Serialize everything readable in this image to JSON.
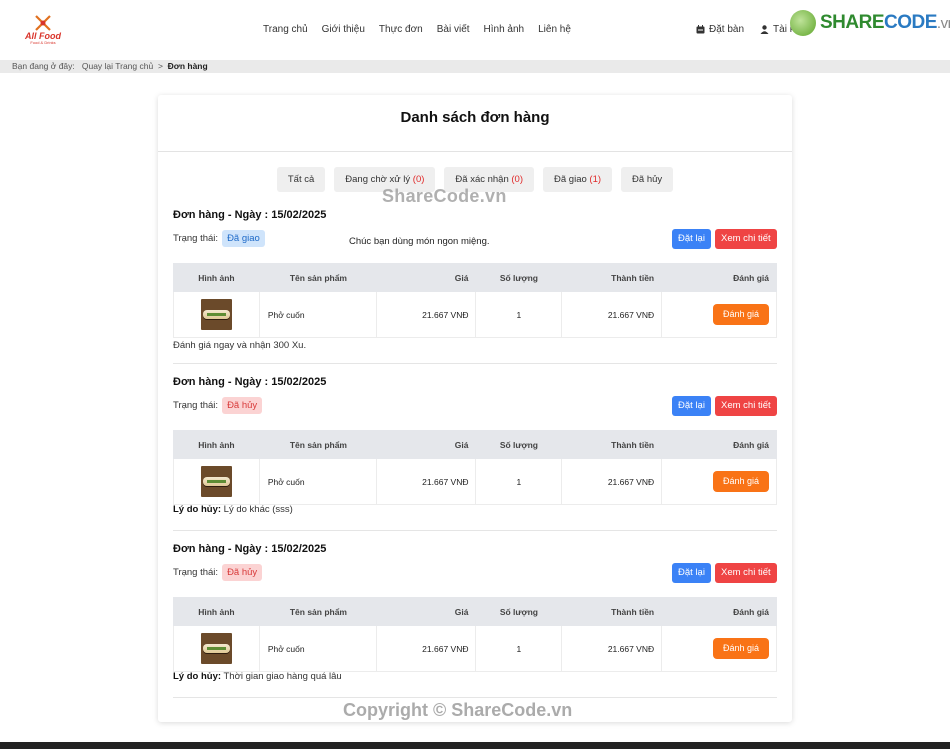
{
  "header": {
    "logo_text": "All Food",
    "logo_sub": "Food & Drinks",
    "nav": [
      "Trang chủ",
      "Giới thiệu",
      "Thực đơn",
      "Bài viết",
      "Hình ảnh",
      "Liên hệ"
    ],
    "booking_label": "Đặt bàn",
    "account_label": "Tài k",
    "watermark_logo": {
      "share": "SHARE",
      "code": "CODE",
      "vn": ".vn"
    }
  },
  "breadcrumb": {
    "prefix": "Bạn đang ở đây:",
    "back": "Quay lại Trang chủ",
    "sep": ">",
    "current": "Đơn hàng"
  },
  "page": {
    "title": "Danh sách đơn hàng",
    "tabs": [
      {
        "label": "Tất cả",
        "count": ""
      },
      {
        "label": "Đang chờ xử lý",
        "count": "(0)"
      },
      {
        "label": "Đã xác nhận",
        "count": "(0)"
      },
      {
        "label": "Đã giao",
        "count": "(1)"
      },
      {
        "label": "Đã hủy",
        "count": ""
      }
    ]
  },
  "table_headers": {
    "image": "Hình ảnh",
    "name": "Tên sản phẩm",
    "price": "Giá",
    "qty": "Số lượng",
    "total": "Thành tiền",
    "rate": "Đánh giá"
  },
  "orders": [
    {
      "title": "Đơn hàng - Ngày : 15/02/2025",
      "status_label": "Trạng thái:",
      "status": "Đã giao",
      "note": "Chúc bạn dùng món ngon miệng.",
      "reorder": "Đặt lại",
      "detail": "Xem chi tiết",
      "item": {
        "name": "Phở cuốn",
        "price": "21.667 VNĐ",
        "qty": "1",
        "total": "21.667 VNĐ",
        "rate": "Đánh giá"
      },
      "footer_label": "",
      "footer_text": "Đánh giá ngay và nhận 300 Xu."
    },
    {
      "title": "Đơn hàng - Ngày : 15/02/2025",
      "status_label": "Trạng thái:",
      "status": "Đã hủy",
      "note": "",
      "reorder": "Đặt lại",
      "detail": "Xem chi tiết",
      "item": {
        "name": "Phở cuốn",
        "price": "21.667 VNĐ",
        "qty": "1",
        "total": "21.667 VNĐ",
        "rate": "Đánh giá"
      },
      "footer_label": "Lý do hủy:",
      "footer_text": " Lý do khác (sss)"
    },
    {
      "title": "Đơn hàng - Ngày : 15/02/2025",
      "status_label": "Trạng thái:",
      "status": "Đã hủy",
      "note": "",
      "reorder": "Đặt lại",
      "detail": "Xem chi tiết",
      "item": {
        "name": "Phở cuốn",
        "price": "21.667 VNĐ",
        "qty": "1",
        "total": "21.667 VNĐ",
        "rate": "Đánh giá"
      },
      "footer_label": "Lý do hủy:",
      "footer_text": " Thời gian giao hàng quá lâu"
    }
  ],
  "watermarks": {
    "top": "ShareCode.vn",
    "bottom": "Copyright © ShareCode.vn"
  },
  "colors": {
    "blue_button": "#3b82f6",
    "red_button": "#ef4444",
    "orange_button": "#f97316"
  }
}
